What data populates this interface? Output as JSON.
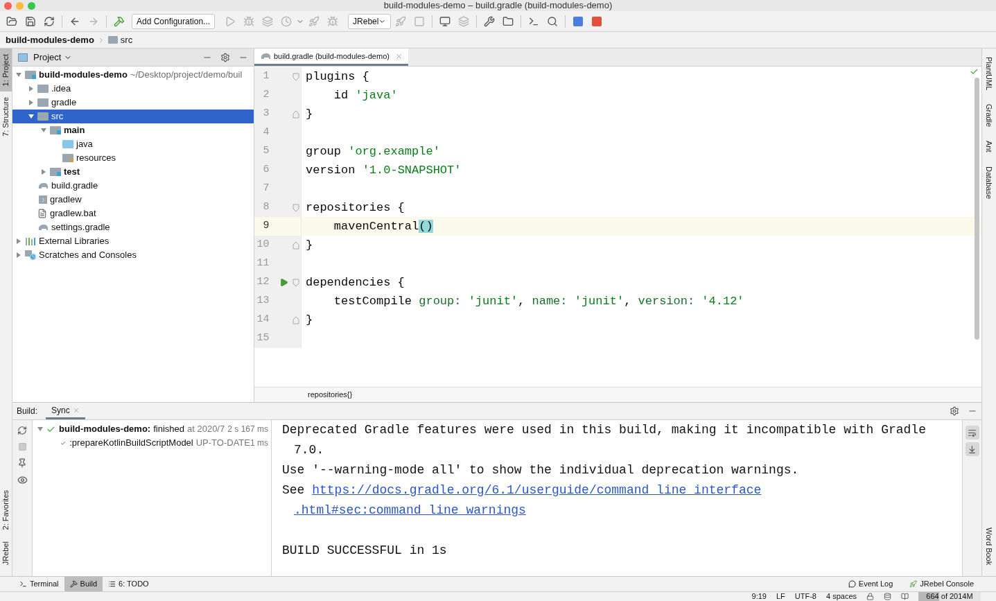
{
  "window": {
    "title": "build-modules-demo – build.gradle (build-modules-demo)"
  },
  "toolbar": {
    "configuration": "Add Configuration...",
    "jrebel_select": "JRebel"
  },
  "breadcrumb": [
    "build-modules-demo",
    "src"
  ],
  "left_stripe": [
    {
      "label": "1: Project",
      "selected": true
    },
    {
      "label": "7: Structure",
      "selected": false
    }
  ],
  "left_stripe_bottom": [
    {
      "label": "2: Favorites",
      "selected": false
    },
    {
      "label": "JRebel",
      "selected": false
    }
  ],
  "right_stripe": [
    "PlantUML",
    "Gradle",
    "Ant",
    "Database"
  ],
  "right_stripe_bottom": [
    "Word Book"
  ],
  "project": {
    "title": "Project",
    "tree": [
      {
        "label": "build-modules-demo",
        "kind": "module",
        "path": "~/Desktop/project/demo/buil",
        "expanded": true,
        "selected": false,
        "children": [
          {
            "label": ".idea",
            "kind": "folder",
            "expanded": false,
            "selected": false
          },
          {
            "label": "gradle",
            "kind": "folder",
            "expanded": false,
            "selected": false
          },
          {
            "label": "src",
            "kind": "folder",
            "expanded": true,
            "selected": true,
            "children": [
              {
                "label": "main",
                "kind": "module",
                "expanded": true,
                "selected": false,
                "children": [
                  {
                    "label": "java",
                    "kind": "source",
                    "selected": false
                  },
                  {
                    "label": "resources",
                    "kind": "resources",
                    "selected": false
                  }
                ]
              },
              {
                "label": "test",
                "kind": "module",
                "expanded": false,
                "selected": false
              }
            ]
          },
          {
            "label": "build.gradle",
            "kind": "gradle",
            "selected": false
          },
          {
            "label": "gradlew",
            "kind": "script",
            "selected": false
          },
          {
            "label": "gradlew.bat",
            "kind": "text",
            "selected": false
          },
          {
            "label": "settings.gradle",
            "kind": "gradle",
            "selected": false
          }
        ]
      },
      {
        "label": "External Libraries",
        "kind": "libraries",
        "expanded": false,
        "selected": false
      },
      {
        "label": "Scratches and Consoles",
        "kind": "scratches",
        "expanded": false,
        "selected": false
      }
    ]
  },
  "editor": {
    "tabs": [
      {
        "label": "build.gradle (build-modules-demo)",
        "selected": true
      }
    ],
    "lines": [
      {
        "number": "1",
        "kind": "fold-start",
        "current": false,
        "run": false,
        "tokens": [
          {
            "t": "plugins {",
            "kind": "plain"
          }
        ]
      },
      {
        "number": "2",
        "kind": "code",
        "current": false,
        "run": false,
        "tokens": [
          {
            "t": "    id ",
            "kind": "plain"
          },
          {
            "t": "'java'",
            "kind": "string"
          }
        ]
      },
      {
        "number": "3",
        "kind": "fold-end",
        "current": false,
        "run": false,
        "tokens": [
          {
            "t": "}",
            "kind": "plain"
          }
        ]
      },
      {
        "number": "4",
        "kind": "code",
        "current": false,
        "run": false
      },
      {
        "number": "5",
        "kind": "code",
        "current": false,
        "run": false,
        "tokens": [
          {
            "t": "group ",
            "kind": "plain"
          },
          {
            "t": "'org.example'",
            "kind": "string"
          }
        ]
      },
      {
        "number": "6",
        "kind": "code",
        "current": false,
        "run": false,
        "tokens": [
          {
            "t": "version ",
            "kind": "plain"
          },
          {
            "t": "'1.0-SNAPSHOT'",
            "kind": "string"
          }
        ]
      },
      {
        "number": "7",
        "kind": "code",
        "current": false,
        "run": false
      },
      {
        "number": "8",
        "kind": "fold-start",
        "current": false,
        "run": false,
        "tokens": [
          {
            "t": "repositories {",
            "kind": "plain"
          }
        ]
      },
      {
        "number": "9",
        "kind": "code",
        "current": true,
        "run": false,
        "tokens": [
          {
            "t": "    mavenCentral",
            "kind": "plain"
          },
          {
            "t": "()",
            "kind": "match"
          }
        ]
      },
      {
        "number": "10",
        "kind": "fold-end",
        "current": false,
        "run": false,
        "tokens": [
          {
            "t": "}",
            "kind": "plain"
          }
        ]
      },
      {
        "number": "11",
        "kind": "code",
        "current": false,
        "run": false
      },
      {
        "number": "12",
        "kind": "fold-start",
        "current": false,
        "run": true,
        "tokens": [
          {
            "t": "dependencies {",
            "kind": "plain"
          }
        ]
      },
      {
        "number": "13",
        "kind": "code",
        "current": false,
        "run": false,
        "tokens": [
          {
            "t": "    testCompile ",
            "kind": "plain"
          },
          {
            "t": "group:",
            "kind": "named"
          },
          {
            "t": " 'junit'",
            "kind": "string"
          },
          {
            "t": ", ",
            "kind": "plain"
          },
          {
            "t": "name:",
            "kind": "named"
          },
          {
            "t": " 'junit'",
            "kind": "string"
          },
          {
            "t": ", ",
            "kind": "plain"
          },
          {
            "t": "version:",
            "kind": "named"
          },
          {
            "t": " '4.12'",
            "kind": "string"
          }
        ]
      },
      {
        "number": "14",
        "kind": "fold-end",
        "current": false,
        "run": false,
        "tokens": [
          {
            "t": "}",
            "kind": "plain"
          }
        ]
      },
      {
        "number": "15",
        "kind": "code",
        "current": false,
        "run": false
      }
    ],
    "breadcrumb": "repositories{}"
  },
  "build": {
    "title": "Build:",
    "tabs": [
      {
        "label": "Sync",
        "selected": true
      }
    ],
    "tree": [
      {
        "name": "build-modules-demo:",
        "status": "finished",
        "detail": "at 2020/7",
        "time": "2 s 167 ms",
        "children": [
          {
            "name": ":prepareKotlinBuildScriptModel",
            "detail": "UP-TO-DATE",
            "time": "1 ms"
          }
        ]
      }
    ],
    "console": [
      {
        "kind": "text",
        "t": "Deprecated Gradle features were used in this build, making it incompatible with Gradle"
      },
      {
        "kind": "indent",
        "t": "7.0."
      },
      {
        "kind": "text",
        "t": "Use '--warning-mode all' to show the individual deprecation warnings."
      },
      {
        "kind": "link",
        "prefix": "See ",
        "t": "https://docs.gradle.org/6.1/userguide/command_line_interface"
      },
      {
        "kind": "link-cont",
        "t": ".html#sec:command_line_warnings"
      },
      {
        "kind": "blank"
      },
      {
        "kind": "text",
        "t": "BUILD SUCCESSFUL in 1s"
      }
    ]
  },
  "tool_tabs": [
    {
      "label": "Terminal",
      "kind": "terminal",
      "selected": false
    },
    {
      "label": "Build",
      "kind": "build",
      "selected": true
    },
    {
      "label": "6: TODO",
      "kind": "todo",
      "selected": false
    }
  ],
  "tool_tabs_right": [
    {
      "label": "Event Log",
      "kind": "log"
    },
    {
      "label": "JRebel Console",
      "kind": "jrebel"
    }
  ],
  "status_bar": {
    "position": "9:19",
    "line_ending": "LF",
    "encoding": "UTF-8",
    "indent": "4 spaces",
    "memory": "664 of 2014M",
    "level": 0.33
  }
}
